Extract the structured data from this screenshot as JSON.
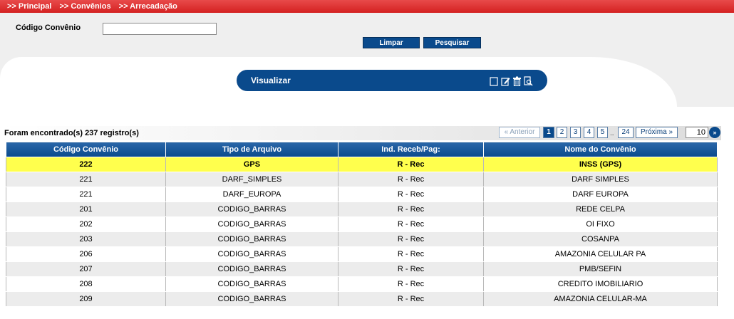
{
  "breadcrumb": [
    ">> Principal",
    ">> Convênios",
    ">> Arrecadação"
  ],
  "search": {
    "label": "Código Convênio",
    "value": "",
    "placeholder": "",
    "clear_label": "Limpar",
    "search_label": "Pesquisar"
  },
  "view_bar": {
    "title": "Visualizar",
    "icons": [
      "checkbox-icon",
      "edit-icon",
      "delete-icon",
      "search-document-icon"
    ]
  },
  "results": {
    "summary": "Foram encontrado(s) 237 registro(s)"
  },
  "pager": {
    "prev": "« Anterior",
    "pages": [
      "1",
      "2",
      "3",
      "4",
      "5"
    ],
    "dots": "..",
    "last": "24",
    "next": "Próxima »",
    "active_page": "1",
    "page_size": "10",
    "go": "»"
  },
  "table": {
    "columns": [
      "Código Convênio",
      "Tipo de Arquivo",
      "Ind. Receb/Pag:",
      "Nome do Convênio"
    ],
    "rows": [
      [
        "222",
        "GPS",
        "R - Rec",
        "INSS (GPS)"
      ],
      [
        "221",
        "DARF_SIMPLES",
        "R - Rec",
        "DARF SIMPLES"
      ],
      [
        "221",
        "DARF_EUROPA",
        "R - Rec",
        "DARF EUROPA"
      ],
      [
        "201",
        "CODIGO_BARRAS",
        "R - Rec",
        "REDE CELPA"
      ],
      [
        "202",
        "CODIGO_BARRAS",
        "R - Rec",
        "OI FIXO"
      ],
      [
        "203",
        "CODIGO_BARRAS",
        "R - Rec",
        "COSANPA"
      ],
      [
        "206",
        "CODIGO_BARRAS",
        "R - Rec",
        "AMAZONIA CELULAR PA"
      ],
      [
        "207",
        "CODIGO_BARRAS",
        "R - Rec",
        "PMB/SEFIN"
      ],
      [
        "208",
        "CODIGO_BARRAS",
        "R - Rec",
        "CREDITO IMOBILIARIO"
      ],
      [
        "209",
        "CODIGO_BARRAS",
        "R - Rec",
        "AMAZONIA CELULAR-MA"
      ]
    ]
  },
  "colors": {
    "header_red": "#d42121",
    "brand_blue": "#0a4a8c",
    "selected_row": "#ffff4d"
  }
}
